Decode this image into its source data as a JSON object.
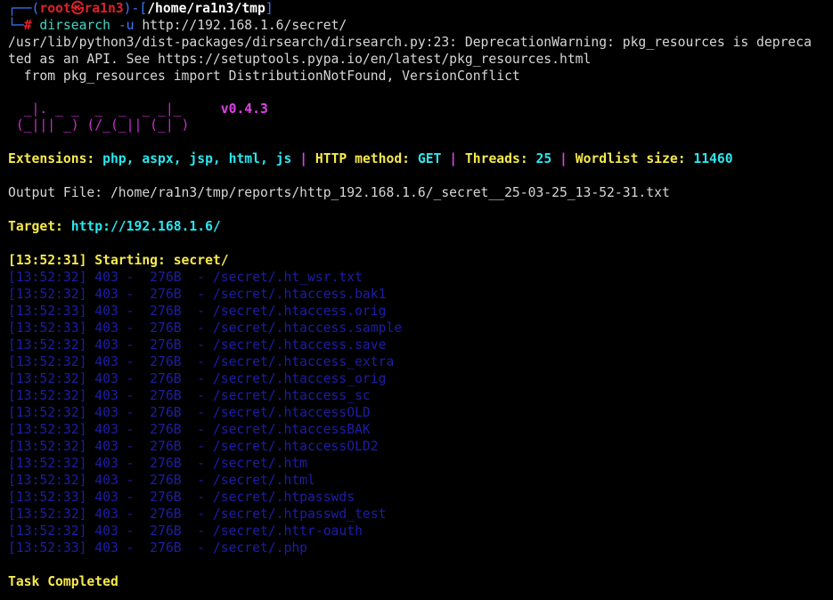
{
  "prompt": {
    "corner_top": "┌──(",
    "user": "root",
    "at_symbol": "㉿",
    "host": "ra1n3",
    "bracket_mid": ")-[",
    "cwd": "/home/ra1n3/tmp",
    "bracket_end": "]",
    "corner_bottom": "└─",
    "hash": "#",
    "command": "dirsearch",
    "flag": "-u",
    "url_arg": "http://192.168.1.6/secret/"
  },
  "warning_lines": [
    "/usr/lib/python3/dist-packages/dirsearch/dirsearch.py:23: DeprecationWarning: pkg_resources is depreca",
    "ted as an API. See https://setuptools.pypa.io/en/latest/pkg_resources.html",
    "  from pkg_resources import DistributionNotFound, VersionConflict"
  ],
  "logo": {
    "line1": "  _|. _ _  _  _  _ _|_",
    "line2": " (_||| _) (/_(_|| (_| )",
    "version": "v0.4.3"
  },
  "config": {
    "extensions_label": "Extensions: ",
    "extensions_value": "php, aspx, jsp, html, js",
    "sep": " | ",
    "method_label": "HTTP method: ",
    "method_value": "GET",
    "threads_label": "Threads: ",
    "threads_value": "25",
    "wordlist_label": "Wordlist size: ",
    "wordlist_value": "11460"
  },
  "output_file": "Output File: /home/ra1n3/tmp/reports/http_192.168.1.6/_secret__25-03-25_13-52-31.txt",
  "target": {
    "label": "Target: ",
    "value": "http://192.168.1.6/"
  },
  "starting": {
    "text": "[13:52:31] Starting: ",
    "path": "secret/"
  },
  "results": [
    "[13:52:32] 403 -  276B  - /secret/.ht_wsr.txt",
    "[13:52:32] 403 -  276B  - /secret/.htaccess.bak1",
    "[13:52:33] 403 -  276B  - /secret/.htaccess.orig",
    "[13:52:33] 403 -  276B  - /secret/.htaccess.sample",
    "[13:52:32] 403 -  276B  - /secret/.htaccess.save",
    "[13:52:32] 403 -  276B  - /secret/.htaccess_extra",
    "[13:52:32] 403 -  276B  - /secret/.htaccess_orig",
    "[13:52:32] 403 -  276B  - /secret/.htaccess_sc",
    "[13:52:32] 403 -  276B  - /secret/.htaccessOLD",
    "[13:52:32] 403 -  276B  - /secret/.htaccessBAK",
    "[13:52:32] 403 -  276B  - /secret/.htaccessOLD2",
    "[13:52:32] 403 -  276B  - /secret/.htm",
    "[13:52:32] 403 -  276B  - /secret/.html",
    "[13:52:33] 403 -  276B  - /secret/.htpasswds",
    "[13:52:32] 403 -  276B  - /secret/.htpasswd_test",
    "[13:52:32] 403 -  276B  - /secret/.httr-oauth",
    "[13:52:33] 403 -  276B  - /secret/.php"
  ],
  "task_completed": "Task Completed",
  "colors": {
    "background": "#000000",
    "prompt_frame": "#3b78ff",
    "user": "#e0202a",
    "results": "#1d1da8",
    "yellow": "#f6e94c",
    "cyan": "#28e7f0",
    "logo": "#d02bd6"
  }
}
